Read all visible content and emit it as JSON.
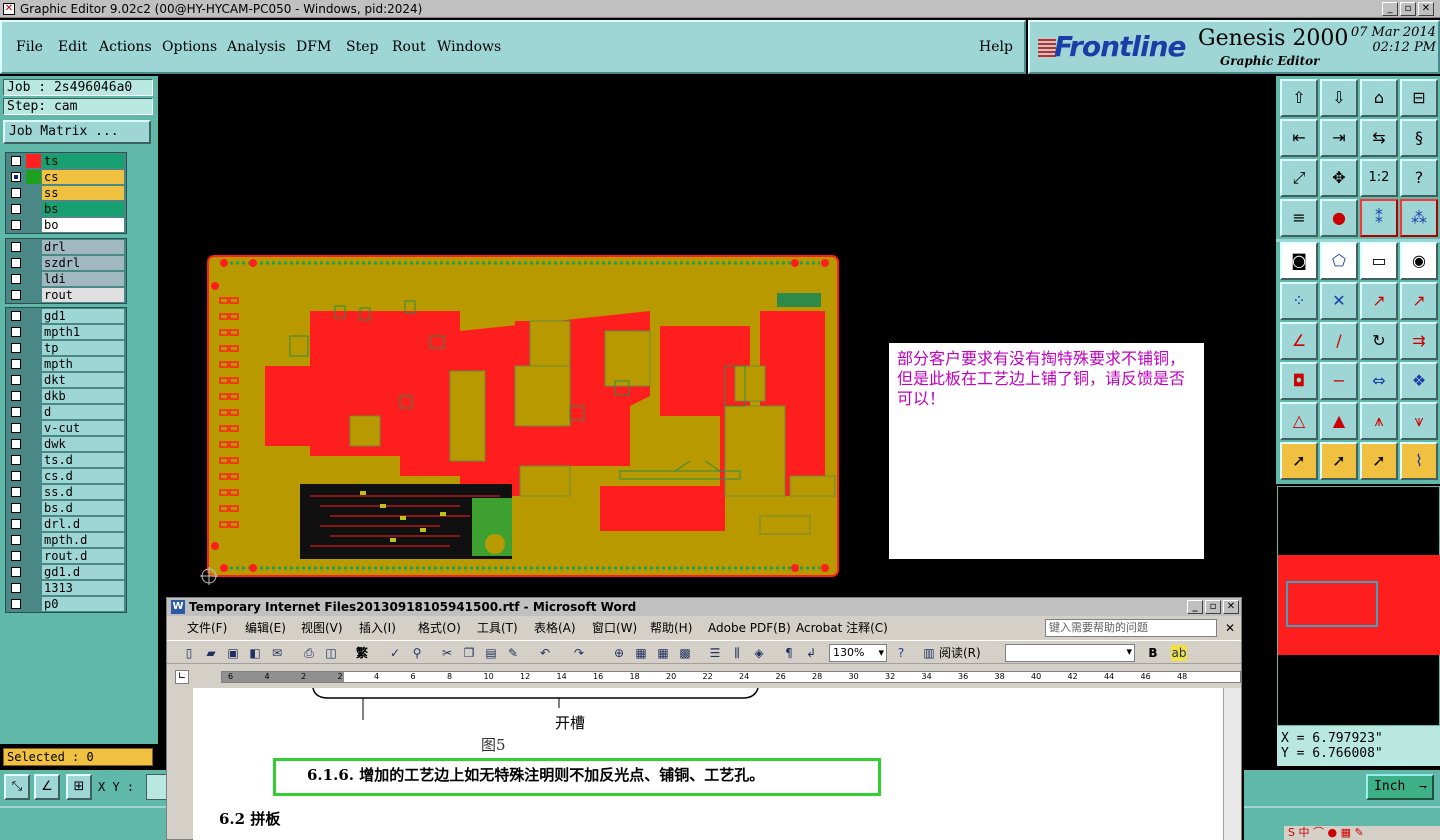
{
  "titlebar": {
    "text": "Graphic Editor 9.02c2 (00@HY-HYCAM-PC050 - Windows, pid:2024)"
  },
  "menu": {
    "items": [
      "File",
      "Edit",
      "Actions",
      "Options",
      "Analysis",
      "DFM",
      "Step",
      "Rout",
      "Windows"
    ],
    "help": "Help"
  },
  "logo": {
    "brand": "Frontline",
    "product": "Genesis 2000",
    "subtitle": "Graphic Editor",
    "date": "07 Mar 2014",
    "time": "02:12 PM"
  },
  "job": {
    "job_label": "Job : 2s496046a0",
    "step_label": "Step: cam",
    "matrix_button": "Job Matrix ...",
    "selected": "Selected : 0"
  },
  "layers": {
    "board": [
      {
        "name": "ts",
        "color": "#ff2020",
        "bg": "#18a070"
      },
      {
        "name": "cs",
        "color": "#20a020",
        "bg": "#f0c040"
      },
      {
        "name": "ss",
        "color": "",
        "bg": "#f0c040"
      },
      {
        "name": "bs",
        "color": "",
        "bg": "#18a070"
      },
      {
        "name": "bo",
        "color": "",
        "bg": "#ffffff"
      }
    ],
    "drill": [
      {
        "name": "drl",
        "bg": "#a0b8c0"
      },
      {
        "name": "szdrl",
        "bg": "#a0b8c0"
      },
      {
        "name": "ldi",
        "bg": "#a0b8c0"
      },
      {
        "name": "rout",
        "bg": "#e0e0e0"
      }
    ],
    "misc": [
      {
        "name": "gd1"
      },
      {
        "name": "mpth1"
      },
      {
        "name": "tp"
      },
      {
        "name": "mpth"
      },
      {
        "name": "dkt"
      },
      {
        "name": "dkb"
      },
      {
        "name": "d"
      },
      {
        "name": "v-cut"
      },
      {
        "name": "dwk"
      },
      {
        "name": "ts.d"
      },
      {
        "name": "cs.d"
      },
      {
        "name": "ss.d"
      },
      {
        "name": "bs.d"
      },
      {
        "name": "drl.d"
      },
      {
        "name": "mpth.d"
      },
      {
        "name": "rout.d"
      },
      {
        "name": "gd1.d"
      },
      {
        "name": "1313"
      },
      {
        "name": "p0"
      }
    ]
  },
  "note": {
    "text": "部分客户要求有没有掏特殊要求不铺铜，但是此板在工艺边上铺了铜，请反馈是否可以！"
  },
  "coords": {
    "x": "X = 6.797923\"",
    "y": "Y = 6.766008\""
  },
  "bottom": {
    "xy_label": "X Y :",
    "unit": "Inch"
  },
  "word": {
    "title": "Temporary Internet Files20130918105941500.rtf - Microsoft Word",
    "menu": [
      "文件(F)",
      "编辑(E)",
      "视图(V)",
      "插入(I)",
      "格式(O)",
      "工具(T)",
      "表格(A)",
      "窗口(W)",
      "帮助(H)",
      "Adobe PDF(B)",
      "Acrobat 注释(C)"
    ],
    "help_placeholder": "键入需要帮助的问题",
    "zoom": "130%",
    "read_label": "阅读(R)",
    "font_trad": "繁",
    "ruler_marks": [
      "6",
      "4",
      "2",
      "2",
      "4",
      "6",
      "8",
      "10",
      "12",
      "14",
      "16",
      "18",
      "20",
      "22",
      "24",
      "26",
      "28",
      "30",
      "32",
      "34",
      "36",
      "38",
      "40",
      "42",
      "44",
      "46",
      "48"
    ],
    "doc": {
      "slot_label": "开槽",
      "figure_label": "图5",
      "highlight": "6.1.6.  增加的工艺边上如无特殊注明则不加反光点、铺铜、工艺孔。",
      "section": "6.2  拼板"
    }
  },
  "colors": {
    "panel": "#5fb8a8",
    "menu": "#9ed6d6",
    "copper": "#b89a00",
    "red_layer": "#ff1e1e"
  }
}
